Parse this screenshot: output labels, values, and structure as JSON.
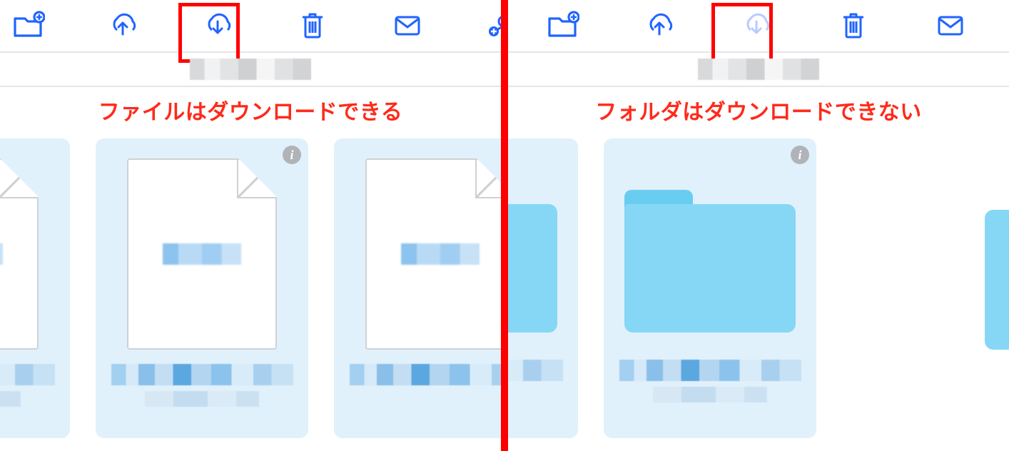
{
  "left": {
    "caption": "ファイルはダウンロードできる",
    "toolbar": {
      "new_folder": "new-folder",
      "upload": "upload",
      "download": "download",
      "trash": "trash",
      "mail": "mail",
      "share": "share-person"
    },
    "download_enabled": true
  },
  "right": {
    "caption": "フォルダはダウンロードできない",
    "toolbar": {
      "new_folder": "new-folder",
      "upload": "upload",
      "download": "download",
      "trash": "trash",
      "mail": "mail"
    },
    "download_enabled": false
  },
  "info_badge": "i"
}
